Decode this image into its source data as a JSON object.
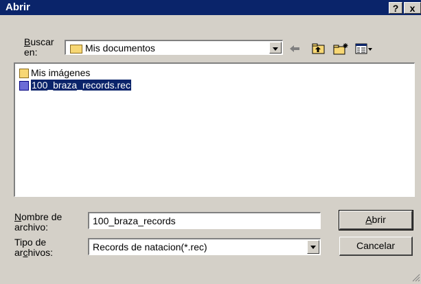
{
  "dialog": {
    "title": "Abrir",
    "help_button": "?",
    "close_button": "x"
  },
  "look_in": {
    "label_line1": "Buscar",
    "label_line1_accel": "B",
    "label_line1_rest": "uscar",
    "label_line2": "en:",
    "value": "Mis documentos"
  },
  "toolbar": {
    "back_icon": "back-arrow-icon",
    "up_icon": "up-folder-icon",
    "new_folder_icon": "new-folder-icon",
    "view_menu_icon": "view-menu-icon"
  },
  "files": [
    {
      "name": "Mis imágenes",
      "icon": "my-pictures-icon",
      "selected": false
    },
    {
      "name": "100_braza_records.rec",
      "icon": "rec-file-icon",
      "selected": true
    }
  ],
  "filename": {
    "label_line1_accel": "N",
    "label_line1_rest": "ombre de",
    "label_line2": "archivo:",
    "value": "100_braza_records"
  },
  "filetype": {
    "label_line1": "Tipo de",
    "label_line2_pre": "ar",
    "label_line2_accel": "c",
    "label_line2_post": "hivos:",
    "value": "Records de natacion(*.rec)"
  },
  "buttons": {
    "open_accel": "A",
    "open_rest": "brir",
    "cancel": "Cancelar"
  },
  "colors": {
    "face": "#d4d0c8",
    "title_bar": "#0a246a",
    "selection": "#0a246a"
  }
}
